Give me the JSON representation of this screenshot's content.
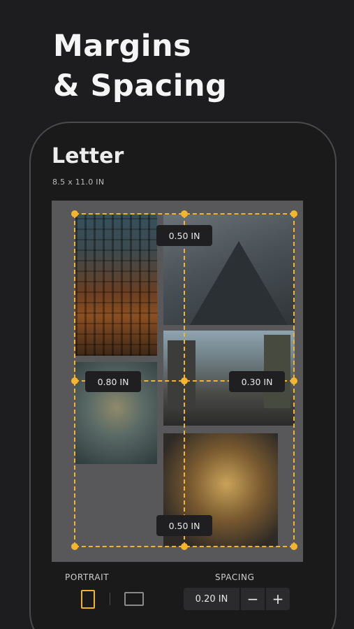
{
  "headline": {
    "line1": "Margins",
    "line2": "& Spacing"
  },
  "document": {
    "title": "Letter",
    "size": "8.5 x 11.0 IN"
  },
  "margins": {
    "top": "0.50 IN",
    "left": "0.80 IN",
    "right": "0.30 IN",
    "bottom": "0.50 IN"
  },
  "controls": {
    "orientation_label": "PORTRAIT",
    "spacing_label": "SPACING",
    "spacing_value": "0.20 IN",
    "minus": "−",
    "plus": "+"
  },
  "colors": {
    "accent": "#f2b42c",
    "background": "#1d1d1f"
  }
}
